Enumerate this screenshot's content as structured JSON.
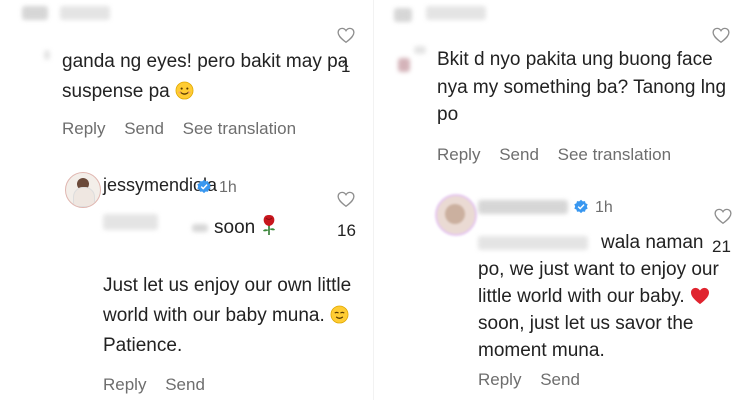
{
  "left": {
    "comment1": {
      "text_line1": "ganda ng eyes! pero bakit may pa",
      "text_line2": "suspense pa",
      "emoji_icon": "smiling-face-icon",
      "reply": "Reply",
      "send": "Send",
      "see_translation": "See translation",
      "likes": "1"
    },
    "reply1": {
      "username": "jessymendiola",
      "time": "1h",
      "soon": "soon",
      "soon_icon": "rose-icon",
      "line1": "Just let us enjoy our own little",
      "line2": "world with our baby muna.",
      "line2_icon": "relieved-face-icon",
      "line3": "Patience.",
      "reply": "Reply",
      "send": "Send",
      "likes": "16"
    }
  },
  "right": {
    "comment1": {
      "line1": "Bkit d nyo pakita ung buong face",
      "line2": "nya my something ba? Tanong lng",
      "line3": "po",
      "reply": "Reply",
      "send": "Send",
      "see_translation": "See translation"
    },
    "reply1": {
      "time": "1h",
      "line1": "wala naman",
      "line2": "po, we just want to enjoy our",
      "line3": "little world with our baby.",
      "line3_icon": "red-heart-icon",
      "line4": "soon, just let us savor the",
      "line5": "moment muna.",
      "reply": "Reply",
      "send": "Send",
      "likes": "21"
    }
  },
  "colors": {
    "text": "#262626",
    "secondary": "#6e6e6e",
    "verified": "#3897f0",
    "heart_red": "#e0242f"
  }
}
